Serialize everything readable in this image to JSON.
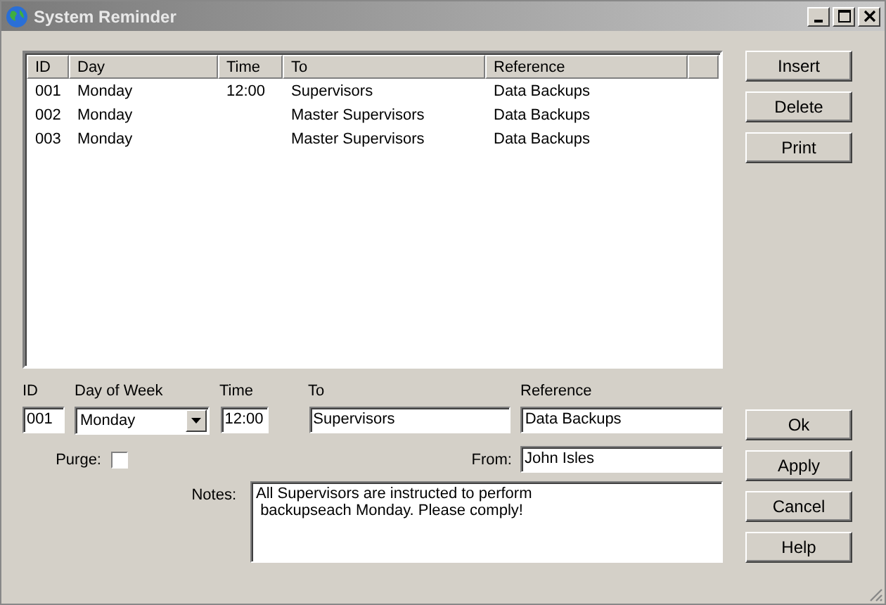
{
  "window": {
    "title": "System Reminder"
  },
  "table": {
    "columns": [
      "ID",
      "Day",
      "Time",
      "To",
      "Reference"
    ],
    "rows": [
      {
        "cells": [
          "001",
          "Monday",
          "12:00",
          "Supervisors",
          "Data Backups"
        ]
      },
      {
        "cells": [
          "002",
          "Monday",
          "",
          "Master Supervisors",
          "Data Backups"
        ]
      },
      {
        "cells": [
          "003",
          "Monday",
          "",
          "Master Supervisors",
          "Data Backups"
        ]
      }
    ]
  },
  "side_buttons": [
    "Insert",
    "Delete",
    "Print"
  ],
  "form": {
    "id_label": "ID",
    "id_value": "001",
    "day_label": "Day of Week",
    "day_value": "Monday",
    "time_label": "Time",
    "time_value": "12:00",
    "to_label": "To",
    "to_value": "Supervisors",
    "reference_label": "Reference",
    "reference_value": "Data Backups",
    "purge_label": "Purge:",
    "purge_checked": false,
    "from_label": "From:",
    "from_value": "John Isles",
    "notes_label": "Notes:",
    "notes_value": "All Supervisors are instructed to perform\n backupseach Monday. Please comply!"
  },
  "dialog_buttons": [
    "Ok",
    "Apply",
    "Cancel",
    "Help"
  ]
}
